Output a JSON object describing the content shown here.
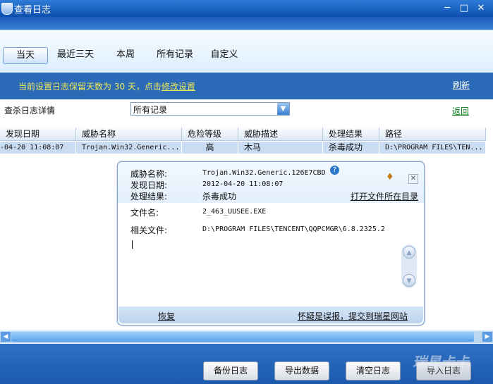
{
  "window": {
    "title": "查看日志",
    "icon": "shield-icon",
    "controls": [
      "minimize-icon",
      "maximize-icon",
      "close-icon"
    ]
  },
  "tabs": [
    {
      "label": "当天",
      "active": true
    },
    {
      "label": "最近三天"
    },
    {
      "label": "本周"
    },
    {
      "label": "所有记录"
    },
    {
      "label": "自定义"
    }
  ],
  "info": {
    "prefix": "当前设置日志保留天数为 30 天，点击",
    "link": "修改设置",
    "refresh": "刷新"
  },
  "filter": {
    "label": "查杀日志详情",
    "selected": "所有记录",
    "back": "返回"
  },
  "table": {
    "headers": [
      "发现日期",
      "威胁名称",
      "危险等级",
      "威胁描述",
      "处理结果",
      "路径"
    ],
    "rows": [
      [
        "-04-20 11:08:07",
        "Trojan.Win32.Generic...",
        "高",
        "木马",
        "杀毒成功",
        "D:\\PROGRAM FILES\\TEN..."
      ]
    ]
  },
  "detail": {
    "threat_name_label": "威胁名称:",
    "threat_name": "Trojan.Win32.Generic.126E7CBD",
    "date_label": "发现日期:",
    "date": "2012-04-20  11:08:07",
    "result_label": "处理结果:",
    "result": "杀毒成功",
    "open_location": "打开文件所在目录",
    "file_label": "文件名:",
    "file": "2_463_UUSEE.EXE",
    "related_label": "相关文件:",
    "related": "D:\\PROGRAM FILES\\TENCENT\\QQPCMGR\\6.8.2325.2",
    "restore": "恢复",
    "report": "怀疑是误报，提交到瑞星网站"
  },
  "buttons": {
    "backup": "备份日志",
    "export": "导出数据",
    "clear": "清空日志",
    "import": "导入日志"
  },
  "watermark": "瑞星卡卡"
}
